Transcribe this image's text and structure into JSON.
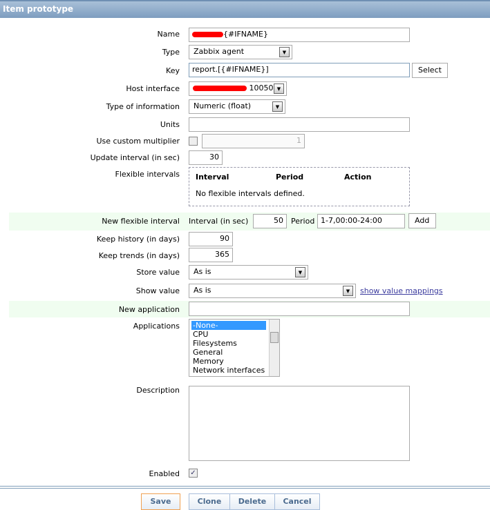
{
  "title": "Item prototype",
  "fields": {
    "name_label": "Name",
    "name_value": "{#IFNAME}",
    "type_label": "Type",
    "type_value": "Zabbix agent",
    "key_label": "Key",
    "key_value": "report.[{#IFNAME}]",
    "select": "Select",
    "host_label": "Host interface",
    "host_value": "10050",
    "info_label": "Type of information",
    "info_value": "Numeric (float)",
    "units_label": "Units",
    "mult_label": "Use custom multiplier",
    "mult_value": "1",
    "update_label": "Update interval (in sec)",
    "update_value": "30",
    "flex_label": "Flexible intervals",
    "flex_cols": [
      "Interval",
      "Period",
      "Action"
    ],
    "flex_empty": "No flexible intervals defined.",
    "newflex_label": "New flexible interval",
    "interval_label": "Interval (in sec)",
    "interval_value": "50",
    "period_label": "Period",
    "period_value": "1-7,00:00-24:00",
    "add": "Add",
    "history_label": "Keep history (in days)",
    "history_value": "90",
    "trends_label": "Keep trends (in days)",
    "trends_value": "365",
    "store_label": "Store value",
    "store_value": "As is",
    "show_label": "Show value",
    "show_value": "As is",
    "mappings": "show value mappings",
    "newapp_label": "New application",
    "apps_label": "Applications",
    "apps": [
      "-None-",
      "CPU",
      "Filesystems",
      "General",
      "Memory",
      "Network interfaces"
    ],
    "desc_label": "Description",
    "enabled_label": "Enabled"
  },
  "buttons": {
    "save": "Save",
    "clone": "Clone",
    "delete": "Delete",
    "cancel": "Cancel"
  }
}
